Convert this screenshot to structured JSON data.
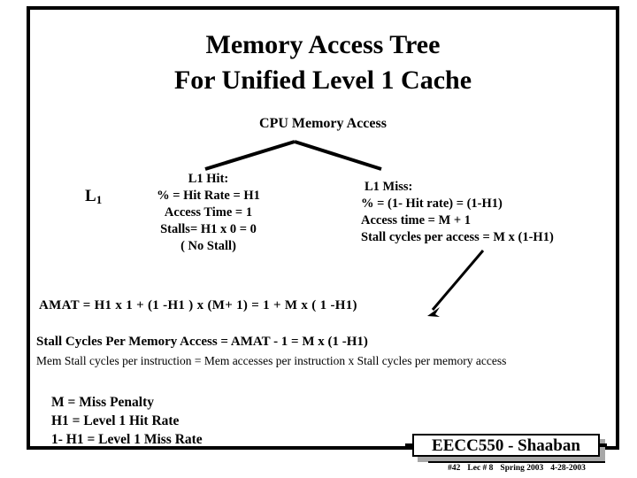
{
  "slide": {
    "title_line1": "Memory Access Tree",
    "title_line2": "For Unified Level 1 Cache",
    "root_node": "CPU Memory  Access",
    "level_label": "L",
    "level_label_sub": "1"
  },
  "hit_branch": {
    "head": "L1  Hit:",
    "rate": "%  =  Hit Rate = H1",
    "access_time": "Access Time = 1",
    "stalls": "Stalls= H1 x 0 = 0",
    "note": "( No Stall)"
  },
  "miss_branch": {
    "head": "L1  Miss:",
    "rate": "%  =  (1- Hit rate)  =  (1-H1)",
    "access_time": "Access time = M  + 1",
    "stall_cycles": "Stall cycles per access  =   M  x (1-H1)"
  },
  "equations": {
    "amat": "AMAT  =      H1  x  1  +     (1 -H1 )   x   (M+ 1)      =        1   +   M  x  ( 1 -H1)",
    "stall_cycles": "Stall Cycles Per Memory Access =  AMAT - 1  =   M  x  (1  -H1)",
    "mem_stall": "Mem Stall cycles per instruction =  Mem  accesses per instruction  x  Stall cycles per memory access"
  },
  "legend": {
    "line1": "M  =  Miss Penalty",
    "line2": "H1  =  Level 1  Hit Rate",
    "line3": "1- H1 = Level 1 Miss Rate"
  },
  "footer": {
    "course": "EECC550 - Shaaban",
    "slide_number": "#42",
    "lecture": "Lec # 8",
    "term": "Spring 2003",
    "date": "4-28-2003"
  },
  "colors": {
    "ink": "#000000",
    "background": "#ffffff",
    "badge_shadow": "#a8a8a8"
  }
}
